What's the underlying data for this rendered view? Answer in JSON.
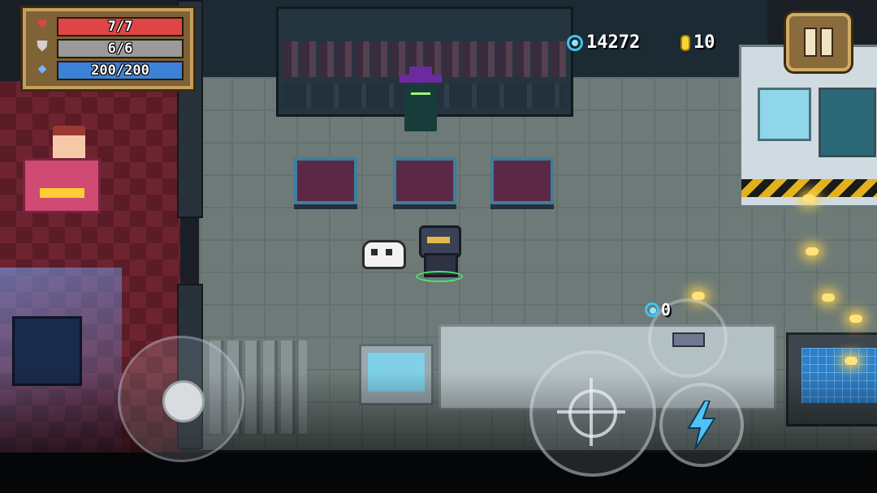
{
  "hud": {
    "health": {
      "icon": "heart-icon",
      "label": "7/7",
      "fraction": 1.0,
      "color": "#e04545"
    },
    "armor": {
      "icon": "shield-icon",
      "label": "6/6",
      "fraction": 1.0,
      "color": "#9a9a9a"
    },
    "energy": {
      "icon": "diamond-icon",
      "label": "200/200",
      "fraction": 1.0,
      "color": "#3b82d6"
    },
    "gems": {
      "icon": "gem-icon",
      "value": "14272"
    },
    "coins": {
      "icon": "coin-icon",
      "value": "10"
    },
    "pause_icon": "pause-icon"
  },
  "controls": {
    "joystick_icon": "joystick-icon",
    "attack_icon": "crosshair-icon",
    "skill_icon": "lightning-icon",
    "weapon_cost": "0",
    "weapon_icon": "gun-icon"
  },
  "colors": {
    "skill_bolt": "#4fc3f7",
    "accent_gold": "#c69f5e"
  }
}
